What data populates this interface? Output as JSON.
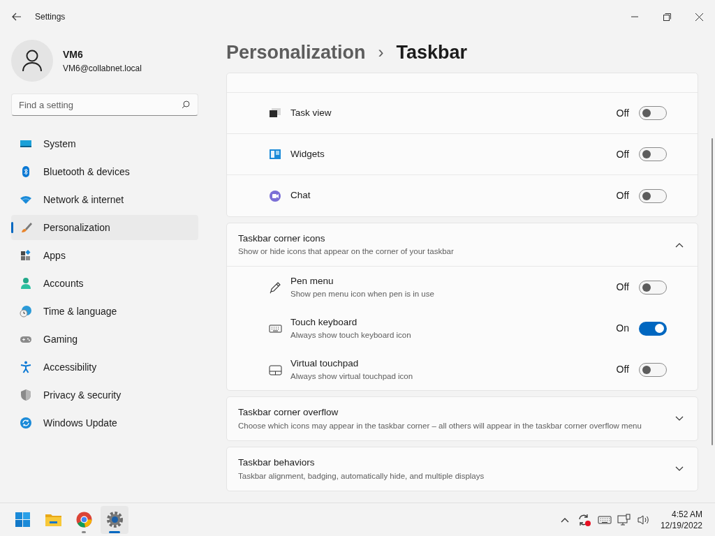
{
  "window": {
    "title": "Settings"
  },
  "user": {
    "name": "VM6",
    "email": "VM6@collabnet.local"
  },
  "search": {
    "placeholder": "Find a setting"
  },
  "sidebar": {
    "items": [
      {
        "label": "System",
        "selected": false
      },
      {
        "label": "Bluetooth & devices",
        "selected": false
      },
      {
        "label": "Network & internet",
        "selected": false
      },
      {
        "label": "Personalization",
        "selected": true
      },
      {
        "label": "Apps",
        "selected": false
      },
      {
        "label": "Accounts",
        "selected": false
      },
      {
        "label": "Time & language",
        "selected": false
      },
      {
        "label": "Gaming",
        "selected": false
      },
      {
        "label": "Accessibility",
        "selected": false
      },
      {
        "label": "Privacy & security",
        "selected": false
      },
      {
        "label": "Windows Update",
        "selected": false
      }
    ]
  },
  "breadcrumb": {
    "parent": "Personalization",
    "separator": "›",
    "current": "Taskbar"
  },
  "sections": [
    {
      "rows": [
        {
          "label": "Task view",
          "state": "Off",
          "on": false
        },
        {
          "label": "Widgets",
          "state": "Off",
          "on": false
        },
        {
          "label": "Chat",
          "state": "Off",
          "on": false
        }
      ]
    },
    {
      "title": "Taskbar corner icons",
      "description": "Show or hide icons that appear on the corner of your taskbar",
      "expanded": true,
      "rows": [
        {
          "label": "Pen menu",
          "description": "Show pen menu icon when pen is in use",
          "state": "Off",
          "on": false
        },
        {
          "label": "Touch keyboard",
          "description": "Always show touch keyboard icon",
          "state": "On",
          "on": true
        },
        {
          "label": "Virtual touchpad",
          "description": "Always show virtual touchpad icon",
          "state": "Off",
          "on": false
        }
      ]
    },
    {
      "title": "Taskbar corner overflow",
      "description": "Choose which icons may appear in the taskbar corner – all others will appear in the taskbar corner overflow menu",
      "expanded": false
    },
    {
      "title": "Taskbar behaviors",
      "description": "Taskbar alignment, badging, automatically hide, and multiple displays",
      "expanded": false
    }
  ],
  "taskbar": {
    "apps": [
      {
        "running": false,
        "selected": false
      },
      {
        "running": false,
        "selected": false
      },
      {
        "running": true,
        "selected": false
      },
      {
        "running": true,
        "selected": true
      }
    ],
    "time": "4:52 AM",
    "date": "12/19/2022"
  }
}
